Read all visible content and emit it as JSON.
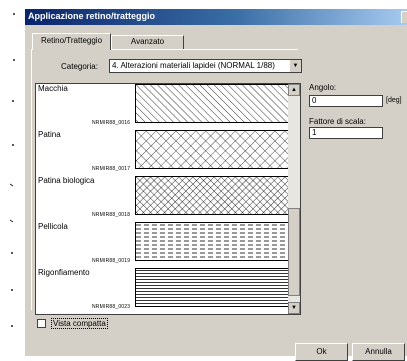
{
  "window": {
    "title": "Applicazione retino/tratteggio"
  },
  "tabs": [
    "Retino/Tratteggio",
    "Avanzato"
  ],
  "category": {
    "label": "Categoria:",
    "value": "4. Alterazioni materiali lapidei (NORMAL 1/88)"
  },
  "patterns": [
    {
      "name": "Macchia",
      "code": "NRMIR88_0016",
      "pattern": "diagonal-hatch"
    },
    {
      "name": "Patina",
      "code": "NRMIR88_0017",
      "pattern": "cross-hatch"
    },
    {
      "name": "Patina biologica",
      "code": "NRMIR88_0018",
      "pattern": "dense-cross-hatch"
    },
    {
      "name": "Pellicola",
      "code": "NRMIR88_0019",
      "pattern": "dashed-lines"
    },
    {
      "name": "Rigonfiamento",
      "code": "NRMIR88_0023",
      "pattern": "horizontal-lines"
    }
  ],
  "angle": {
    "label": "Angolo:",
    "value": "0",
    "unit": "[deg]"
  },
  "scale": {
    "label": "Fattore di scala:",
    "value": "1"
  },
  "compact_view": {
    "label": "Vista compatta",
    "checked": false
  },
  "buttons": {
    "ok": "Ok",
    "cancel": "Annulla"
  },
  "icons": {
    "combo_arrow": "chevron-down-icon",
    "scroll_up": "scroll-up-icon",
    "scroll_down": "scroll-down-icon"
  },
  "colors": {
    "title_start": "#0a246a",
    "title_end": "#a6caf0",
    "face": "#d4d0c8"
  }
}
